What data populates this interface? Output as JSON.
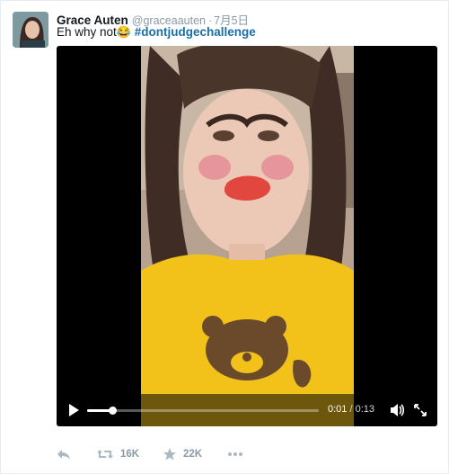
{
  "tweet": {
    "display_name": "Grace Auten",
    "handle": "@graceaauten",
    "separator": "·",
    "date": "7月5日",
    "text_before": "Eh why not",
    "emoji": "😂",
    "hashtag": "#dontjudgechallenge"
  },
  "video": {
    "elapsed": "0:01",
    "duration_sep": " / ",
    "duration": "0:13",
    "progress_fraction": 0.11,
    "icons": [
      "play-icon",
      "volume-icon",
      "fullscreen-icon"
    ]
  },
  "actions": {
    "retweet_count": "16K",
    "like_count": "22K",
    "icons": [
      "reply-icon",
      "retweet-icon",
      "like-icon",
      "more-icon"
    ]
  },
  "colors": {
    "name": "#14171a",
    "muted": "#8899a6",
    "hashtag": "#1b6fa8",
    "shirt": "#f2c21b"
  }
}
